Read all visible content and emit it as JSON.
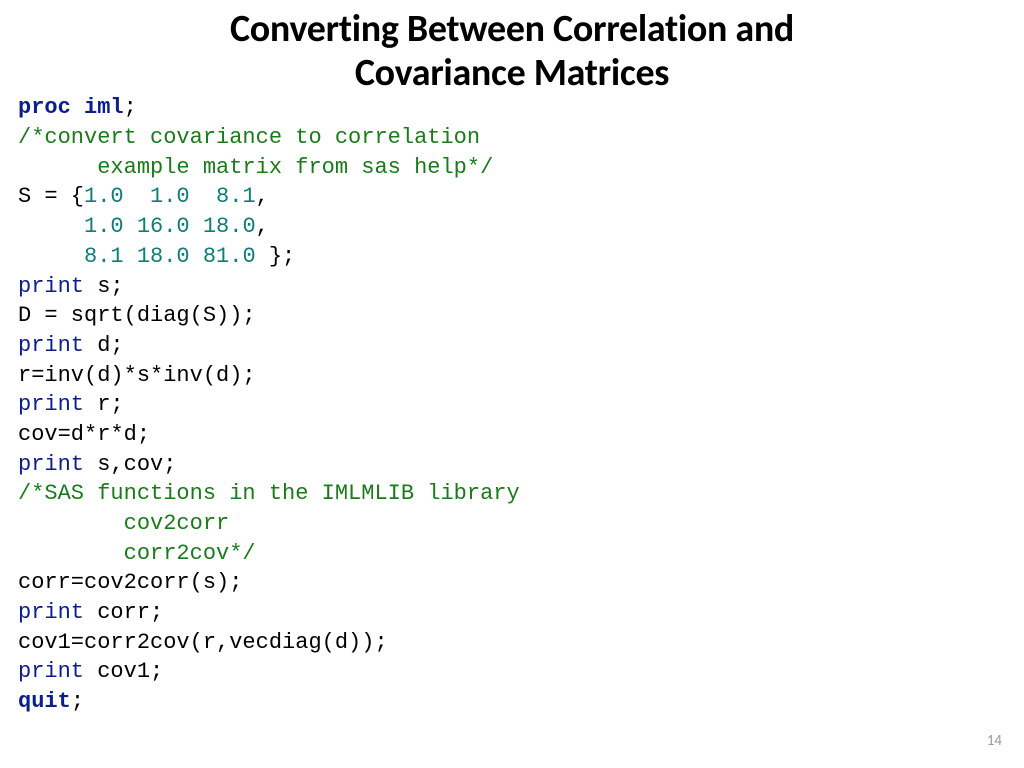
{
  "title_line1": "Converting Between Correlation and",
  "title_line2": "Covariance Matrices",
  "page_number": "14",
  "code": {
    "l01a": "proc",
    "l01b": " ",
    "l01c": "iml",
    "l01d": ";",
    "l02": "/*convert covariance to correlation",
    "l03": "      example matrix from sas help*/",
    "l04a": "S = {",
    "l04b": "1.0  1.0  8.1",
    "l04c": ",",
    "l05a": "     ",
    "l05b": "1.0 16.0 18.0",
    "l05c": ",",
    "l06a": "     ",
    "l06b": "8.1 18.0 81.0 ",
    "l06c": "};",
    "l07a": "print",
    "l07b": " s;",
    "l08": "D = sqrt(diag(S));",
    "l09a": "print",
    "l09b": " d;",
    "l10": "r=inv(d)*s*inv(d);",
    "l11a": "print",
    "l11b": " r;",
    "l12": "cov=d*r*d;",
    "l13a": "print",
    "l13b": " s,cov;",
    "l14": "/*SAS functions in the IMLMLIB library",
    "l15": "        cov2corr",
    "l16": "        corr2cov*/",
    "l17": "corr=cov2corr(s);",
    "l18a": "print",
    "l18b": " corr;",
    "l19": "cov1=corr2cov(r,vecdiag(d));",
    "l20a": "print",
    "l20b": " cov1;",
    "l21a": "quit",
    "l21b": ";"
  }
}
